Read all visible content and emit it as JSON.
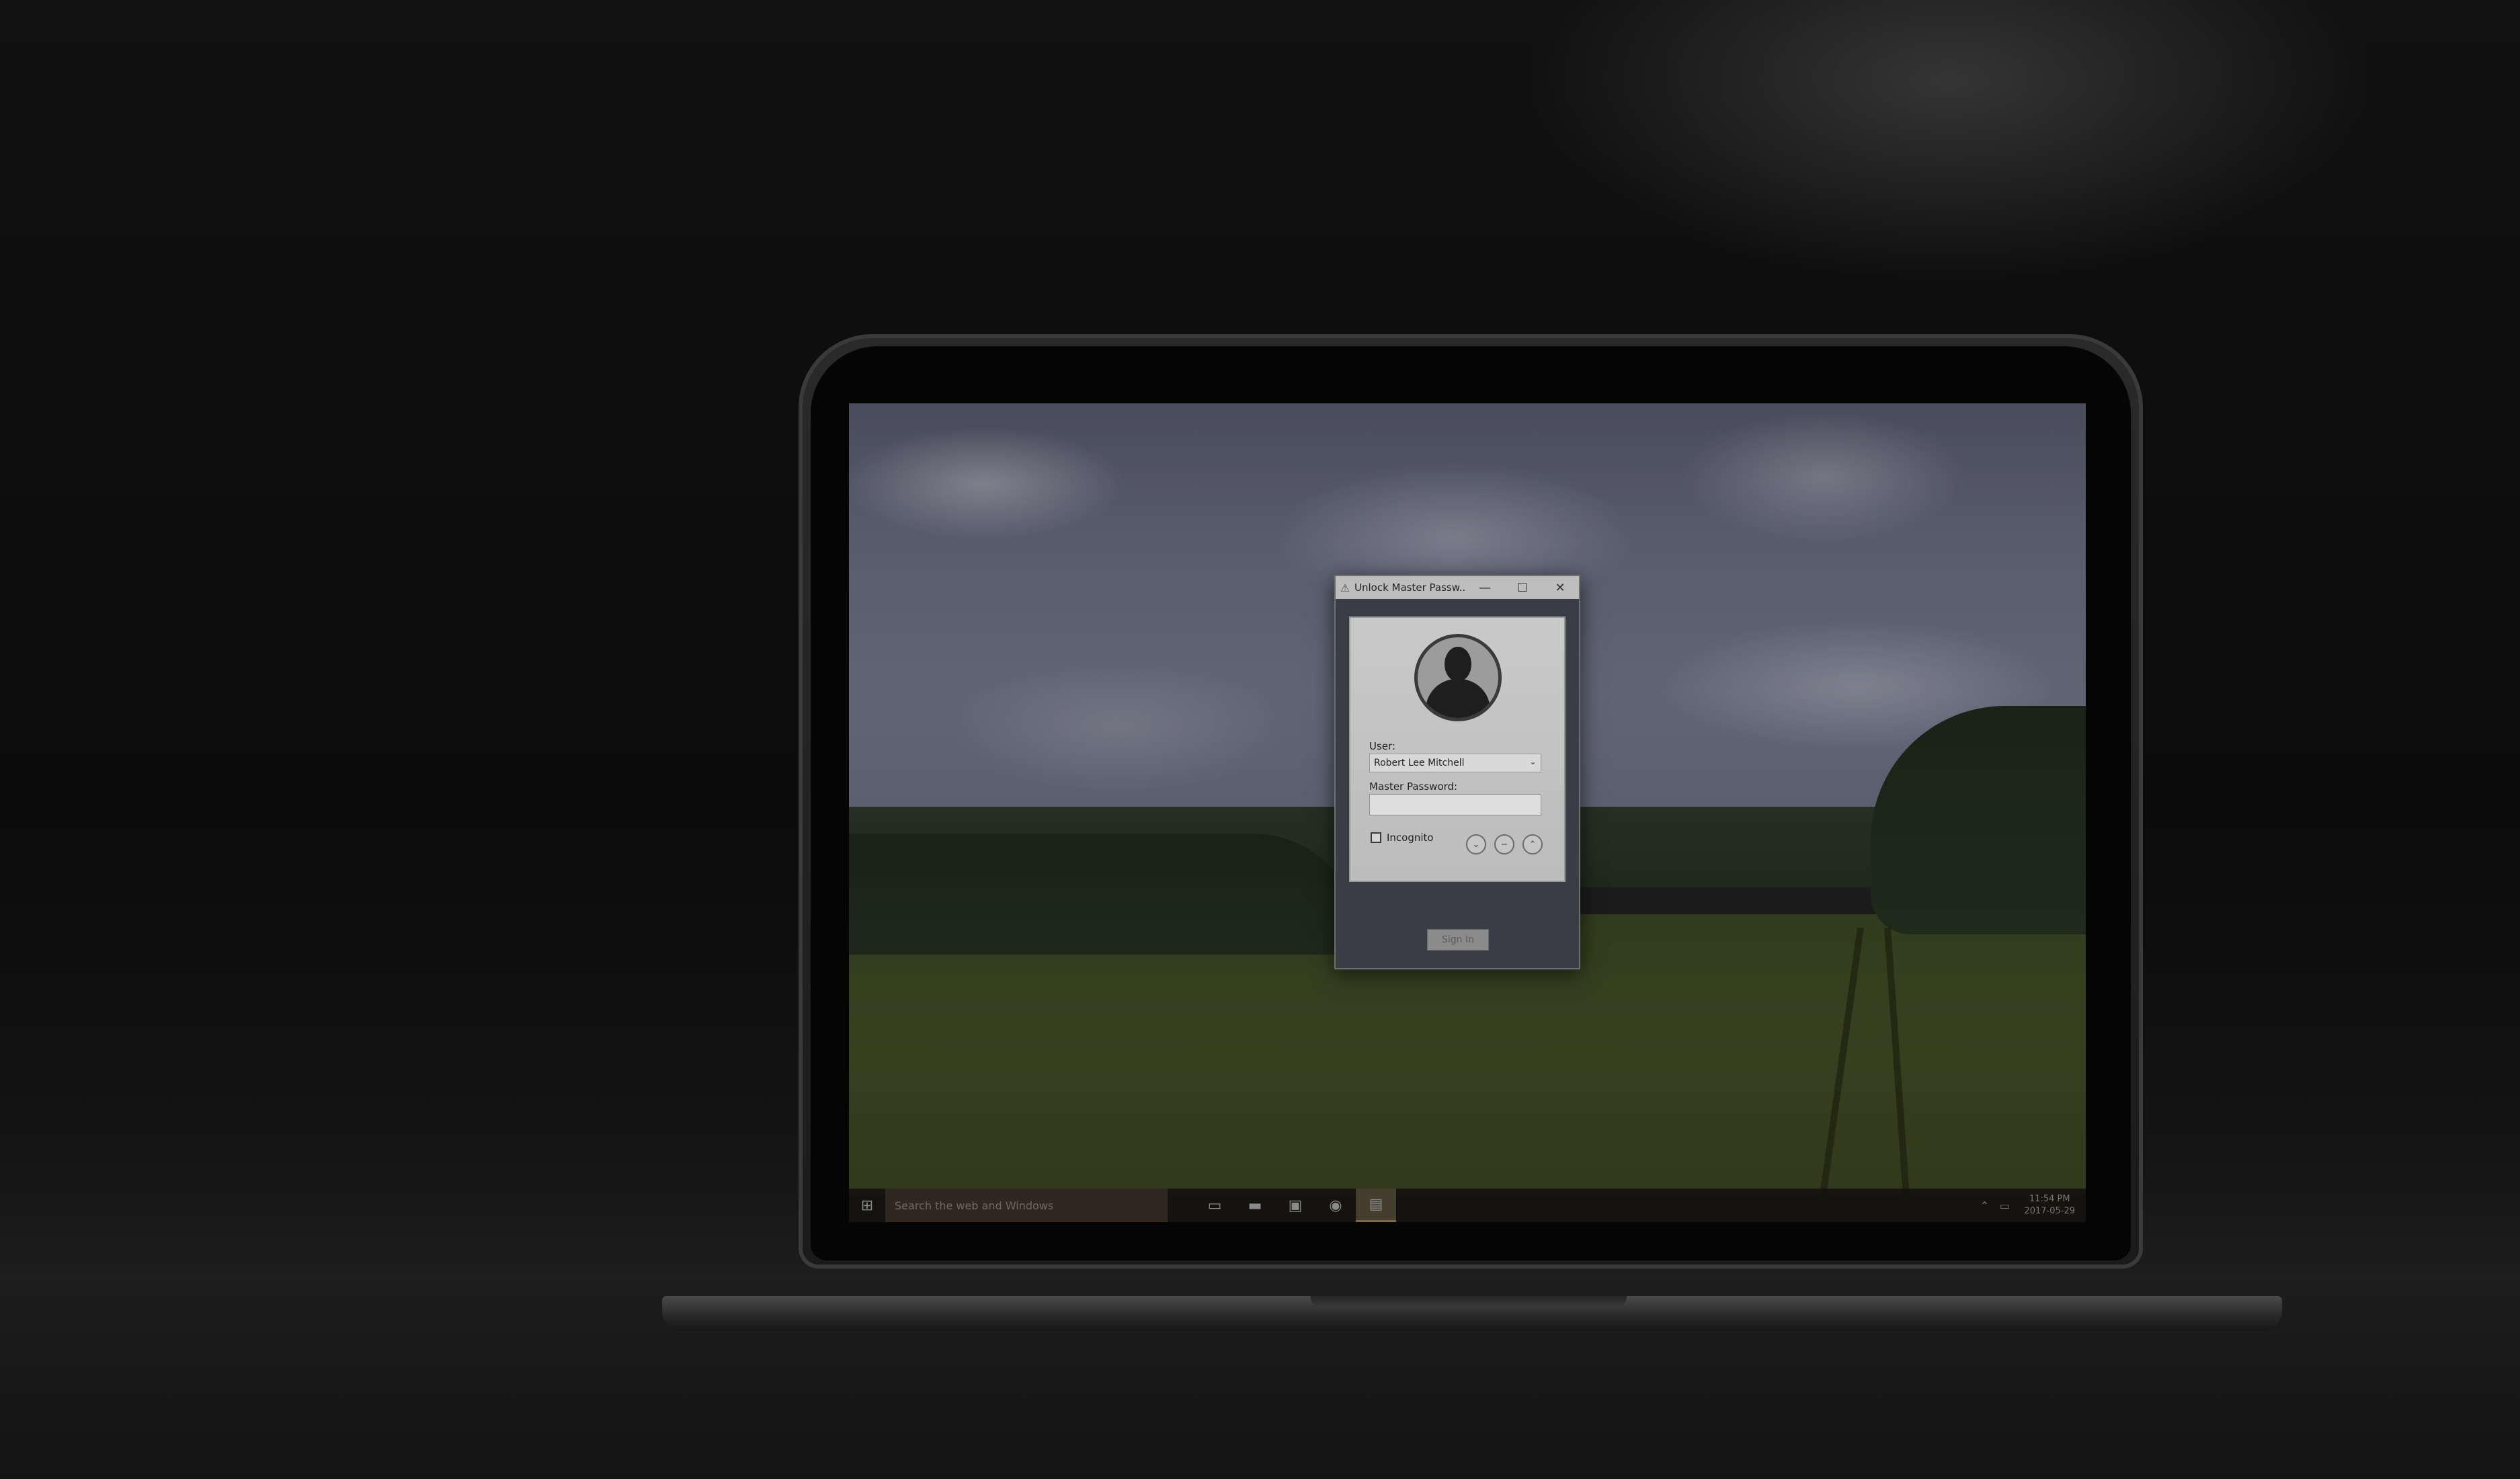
{
  "dialog": {
    "title": "Unlock Master Passw...",
    "minimize_glyph": "—",
    "maximize_glyph": "☐",
    "close_glyph": "✕",
    "user_label": "User:",
    "user_value": "Robert Lee Mitchell",
    "password_label": "Master Password:",
    "password_value": "",
    "incognito_label": "Incognito",
    "signin_label": "Sign In"
  },
  "taskbar": {
    "search_placeholder": "Search the web and Windows",
    "clock_time": "11:54 PM",
    "clock_date": "2017-05-29",
    "icons": [
      "windows-start-icon",
      "task-view-icon",
      "file-explorer-icon",
      "terminal-icon",
      "chrome-icon",
      "master-password-app-icon"
    ]
  }
}
